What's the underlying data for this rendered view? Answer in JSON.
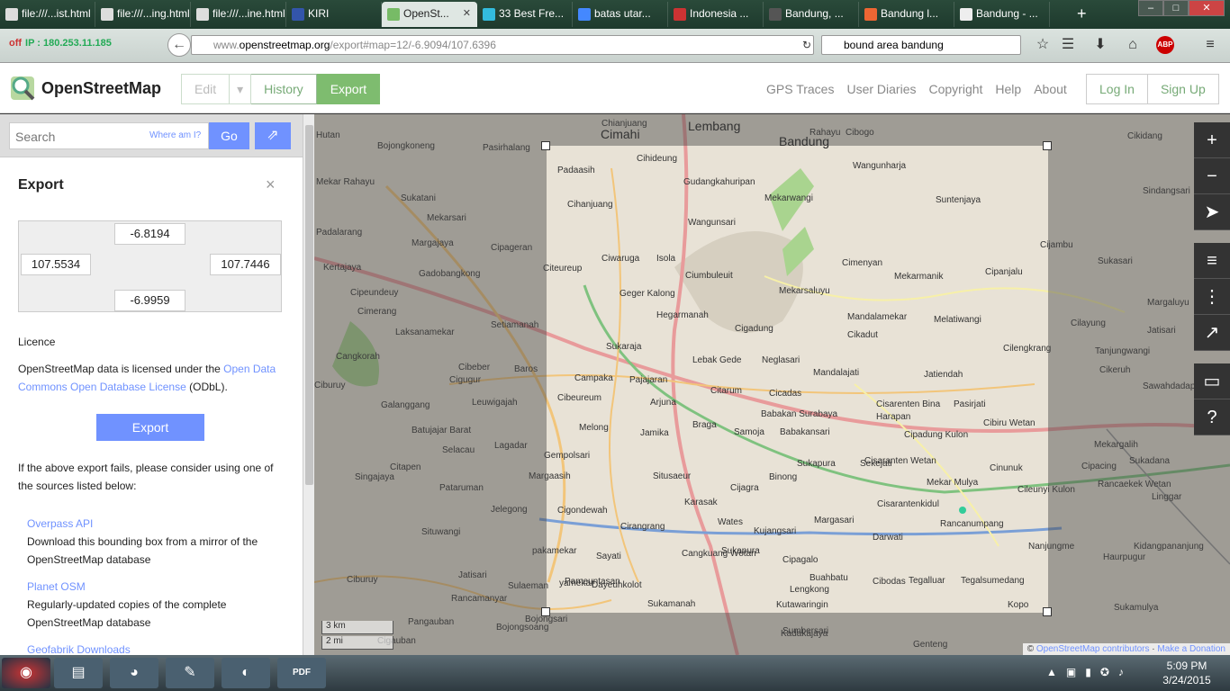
{
  "browser": {
    "tabs": [
      {
        "label": "file:///...ist.html",
        "icon": "file-icon",
        "active": false
      },
      {
        "label": "file:///...ing.html",
        "icon": "file-icon",
        "active": false
      },
      {
        "label": "file:///...ine.html",
        "icon": "file-icon",
        "active": false
      },
      {
        "label": "KIRI",
        "icon": "kiri-icon",
        "active": false
      },
      {
        "label": "OpenSt...",
        "icon": "osm-icon",
        "active": true
      },
      {
        "label": "33 Best Fre...",
        "icon": "crown-icon",
        "active": false
      },
      {
        "label": "batas utar...",
        "icon": "google-icon",
        "active": false
      },
      {
        "label": "Indonesia ...",
        "icon": "flag-icon",
        "active": false
      },
      {
        "label": "Bandung, ...",
        "icon": "globe-icon",
        "active": false
      },
      {
        "label": "Bandung l...",
        "icon": "blogger-icon",
        "active": false
      },
      {
        "label": "Bandung - ...",
        "icon": "wikipedia-icon",
        "active": false
      }
    ],
    "ip_status": "off",
    "ip_text": "IP : 180.253.11.185",
    "url_prefix": "www.",
    "url_host": "openstreetmap.org",
    "url_path": "/export#map=12/-6.9094/107.6396",
    "search_query": "bound area bandung"
  },
  "osm": {
    "brand": "OpenStreetMap",
    "edit_label": "Edit",
    "history_label": "History",
    "export_label": "Export",
    "nav_links": [
      "GPS Traces",
      "User Diaries",
      "Copyright",
      "Help",
      "About"
    ],
    "login_label": "Log In",
    "signup_label": "Sign Up",
    "search_placeholder": "Search",
    "where_am_i": "Where am I?",
    "go_label": "Go"
  },
  "export_panel": {
    "title": "Export",
    "bbox": {
      "north": "-6.8194",
      "west": "107.5534",
      "east": "107.7446",
      "south": "-6.9959"
    },
    "licence_heading": "Licence",
    "licence_text_before": "OpenStreetMap data is licensed under the ",
    "licence_link": "Open Data Commons Open Database License",
    "licence_text_after": " (ODbL).",
    "export_button": "Export",
    "fail_text": "If the above export fails, please consider using one of the sources listed below:",
    "sources": [
      {
        "name": "Overpass API",
        "desc": "Download this bounding box from a mirror of the OpenStreetMap database"
      },
      {
        "name": "Planet OSM",
        "desc": "Regularly-updated copies of the complete OpenStreetMap database"
      },
      {
        "name": "Geofabrik Downloads",
        "desc": ""
      }
    ]
  },
  "map": {
    "places": [
      {
        "name": "Lembang",
        "big": true
      },
      {
        "name": "Cimahi",
        "big": true
      },
      {
        "name": "Bandung",
        "big": true
      },
      {
        "name": "Chianjuang",
        "big": false
      },
      {
        "name": "Rahayu",
        "big": false
      },
      {
        "name": "Cibogo",
        "big": false
      },
      {
        "name": "Cikidang",
        "big": false
      },
      {
        "name": "Hutan",
        "big": false
      },
      {
        "name": "Bojongkoneng",
        "big": false
      },
      {
        "name": "Pasirhalang",
        "big": false
      },
      {
        "name": "Padaasih",
        "big": false
      },
      {
        "name": "Cihideung",
        "big": false
      },
      {
        "name": "Wangunharja",
        "big": false
      },
      {
        "name": "Gudangkahuripan",
        "big": false
      },
      {
        "name": "Mekarwangi",
        "big": false
      },
      {
        "name": "Suntenjaya",
        "big": false
      },
      {
        "name": "Sukatani",
        "big": false
      },
      {
        "name": "Mekarsari",
        "big": false
      },
      {
        "name": "Cihanjuang",
        "big": false
      },
      {
        "name": "Wangunsari",
        "big": false
      },
      {
        "name": "Padalarang",
        "big": false
      },
      {
        "name": "Margajaya",
        "big": false
      },
      {
        "name": "Cipageran",
        "big": false
      },
      {
        "name": "Ciwaruga",
        "big": false
      },
      {
        "name": "Isola",
        "big": false
      },
      {
        "name": "Cimenyan",
        "big": false
      },
      {
        "name": "Mekarmanik",
        "big": false
      },
      {
        "name": "Cipanjalu",
        "big": false
      },
      {
        "name": "Kertajaya",
        "big": false
      },
      {
        "name": "Gadobangkong",
        "big": false
      },
      {
        "name": "Citeureup",
        "big": false
      },
      {
        "name": "Ciumbuleuit",
        "big": false
      },
      {
        "name": "Cipeundeuy",
        "big": false
      },
      {
        "name": "Geger Kalong",
        "big": false
      },
      {
        "name": "Mekarsaluyu",
        "big": false
      },
      {
        "name": "Cimerang",
        "big": false
      },
      {
        "name": "Hegarmanah",
        "big": false
      },
      {
        "name": "Mandalamekar",
        "big": false
      },
      {
        "name": "Melatiwangi",
        "big": false
      },
      {
        "name": "Setiamanah",
        "big": false
      },
      {
        "name": "Cigadung",
        "big": false
      },
      {
        "name": "Cikadut",
        "big": false
      },
      {
        "name": "Laksanamekar",
        "big": false
      },
      {
        "name": "Sukaraja",
        "big": false
      },
      {
        "name": "Cilengkrang",
        "big": false
      },
      {
        "name": "Cangkorah",
        "big": false
      },
      {
        "name": "Lebak Gede",
        "big": false
      },
      {
        "name": "Neglasari",
        "big": false
      },
      {
        "name": "Baros",
        "big": false
      },
      {
        "name": "Cibeber",
        "big": false
      },
      {
        "name": "Campaka",
        "big": false
      },
      {
        "name": "Pajajaran",
        "big": false
      },
      {
        "name": "Mandalajati",
        "big": false
      },
      {
        "name": "Jatiendah",
        "big": false
      },
      {
        "name": "Cigugur",
        "big": false
      },
      {
        "name": "Citarum",
        "big": false
      },
      {
        "name": "Cicadas",
        "big": false
      },
      {
        "name": "Cisarenten Bina",
        "big": false
      },
      {
        "name": "Pasirjati",
        "big": false
      },
      {
        "name": "Galanggang",
        "big": false
      },
      {
        "name": "Leuwigajah",
        "big": false
      },
      {
        "name": "Cibeureum",
        "big": false
      },
      {
        "name": "Arjuna",
        "big": false
      },
      {
        "name": "Babakan Surabaya",
        "big": false
      },
      {
        "name": "Harapan",
        "big": false
      },
      {
        "name": "Batujajar Barat",
        "big": false
      },
      {
        "name": "Braga",
        "big": false
      },
      {
        "name": "Melong",
        "big": false
      },
      {
        "name": "Jamika",
        "big": false
      },
      {
        "name": "Samoja",
        "big": false
      },
      {
        "name": "Babakansari",
        "big": false
      },
      {
        "name": "Cipadung Kulon",
        "big": false
      },
      {
        "name": "Cibiru Wetan",
        "big": false
      },
      {
        "name": "Selacau",
        "big": false
      },
      {
        "name": "Lagadar",
        "big": false
      },
      {
        "name": "Gempolsari",
        "big": false
      },
      {
        "name": "Cisaranten Wetan",
        "big": false
      },
      {
        "name": "Cinunuk",
        "big": false
      },
      {
        "name": "Cipacing",
        "big": false
      },
      {
        "name": "Citapen",
        "big": false
      },
      {
        "name": "Margaasih",
        "big": false
      },
      {
        "name": "Situsaeur",
        "big": false
      },
      {
        "name": "Binong",
        "big": false
      },
      {
        "name": "Sukapura",
        "big": false
      },
      {
        "name": "Sekejati",
        "big": false
      },
      {
        "name": "Mekar Mulya",
        "big": false
      },
      {
        "name": "Cileunyi Kulon",
        "big": false
      },
      {
        "name": "Singajaya",
        "big": false
      },
      {
        "name": "Pataruman",
        "big": false
      },
      {
        "name": "Jelegong",
        "big": false
      },
      {
        "name": "Cigondewah",
        "big": false
      },
      {
        "name": "Cijagra",
        "big": false
      },
      {
        "name": "Cisarantenkidul",
        "big": false
      },
      {
        "name": "Situwangi",
        "big": false
      },
      {
        "name": "Cirangrang",
        "big": false
      },
      {
        "name": "Karasak",
        "big": false
      },
      {
        "name": "Wates",
        "big": false
      },
      {
        "name": "Margasari",
        "big": false
      },
      {
        "name": "Rancanumpang",
        "big": false
      },
      {
        "name": "Kujangsari",
        "big": false
      },
      {
        "name": "Darwati",
        "big": false
      },
      {
        "name": "Sayati",
        "big": false
      },
      {
        "name": "Cangkuang Wetan",
        "big": false
      },
      {
        "name": "Sukapura",
        "big": false
      },
      {
        "name": "Cipagalo",
        "big": false
      },
      {
        "name": "Jatisari",
        "big": false
      },
      {
        "name": "Pameuntasan",
        "big": false
      },
      {
        "name": "Buahbatu",
        "big": false
      },
      {
        "name": "Tegalluar",
        "big": false
      },
      {
        "name": "Tegalsumedang",
        "big": false
      },
      {
        "name": "Sulaeman",
        "big": false
      },
      {
        "name": "Dayeuhkolot",
        "big": false
      },
      {
        "name": "Lengkong",
        "big": false
      },
      {
        "name": "Cibodas",
        "big": false
      },
      {
        "name": "Rancamanyar",
        "big": false
      },
      {
        "name": "Sukamanah",
        "big": false
      },
      {
        "name": "Kutawaringin",
        "big": false
      },
      {
        "name": "Kopo",
        "big": false
      },
      {
        "name": "Pangauban",
        "big": false
      },
      {
        "name": "Bojongsoang",
        "big": false
      },
      {
        "name": "Bojongsari",
        "big": false
      },
      {
        "name": "Sumbersari",
        "big": false
      },
      {
        "name": "Kadakajaya",
        "big": false
      },
      {
        "name": "Genteng",
        "big": false
      },
      {
        "name": "Cijambu",
        "big": false
      },
      {
        "name": "Sukasari",
        "big": false
      },
      {
        "name": "Sindangsari",
        "big": false
      },
      {
        "name": "Margaluyu",
        "big": false
      },
      {
        "name": "Cilayung",
        "big": false
      },
      {
        "name": "Jatisari",
        "big": false
      },
      {
        "name": "Tanjungwangi",
        "big": false
      },
      {
        "name": "Cikeruh",
        "big": false
      },
      {
        "name": "Sawahdadap",
        "big": false
      },
      {
        "name": "Mekargalih",
        "big": false
      },
      {
        "name": "Sukadana",
        "big": false
      },
      {
        "name": "Rancaekek Wetan",
        "big": false
      },
      {
        "name": "Linggar",
        "big": false
      },
      {
        "name": "Nanjungme",
        "big": false
      },
      {
        "name": "Haurpugur",
        "big": false
      },
      {
        "name": "Kidangpananjung",
        "big": false
      },
      {
        "name": "Sukamulya",
        "big": false
      },
      {
        "name": "Ciburuy",
        "big": false
      },
      {
        "name": "Cigauban",
        "big": false
      },
      {
        "name": "Mekar Rahayu",
        "big": false
      },
      {
        "name": "Ciburuy",
        "big": false
      },
      {
        "name": "pakamekar",
        "big": false
      },
      {
        "name": "yamekar",
        "big": false
      }
    ],
    "scale": [
      "3 km",
      "2 mi"
    ],
    "attribution_prefix": "© ",
    "attribution_link": "OpenStreetMap contributors",
    "donate_link": "Make a Donation",
    "controls": [
      {
        "icon": "zoom-in-icon",
        "glyph": "+"
      },
      {
        "icon": "zoom-out-icon",
        "glyph": "−"
      },
      {
        "icon": "locate-icon",
        "glyph": "➤"
      },
      {
        "icon": "layers-icon",
        "glyph": "≡"
      },
      {
        "icon": "info-icon",
        "glyph": "⋮"
      },
      {
        "icon": "share-icon",
        "glyph": "↗"
      },
      {
        "icon": "note-icon",
        "glyph": "▭"
      },
      {
        "icon": "query-icon",
        "glyph": "?"
      }
    ]
  },
  "taskbar": {
    "time": "5:09 PM",
    "date": "3/24/2015"
  }
}
